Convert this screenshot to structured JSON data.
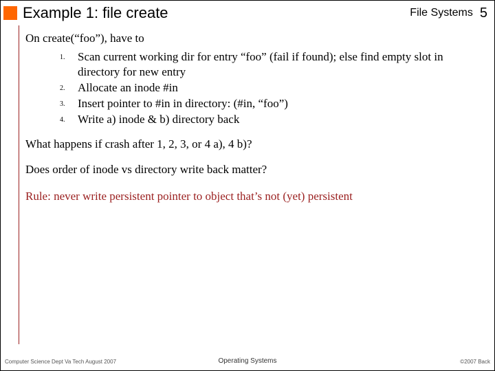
{
  "header": {
    "title": "Example 1: file create",
    "unit": "File Systems",
    "page": "5"
  },
  "body": {
    "lead": "On create(“foo”), have to",
    "steps": [
      {
        "n": "1.",
        "t": "Scan current working dir for entry “foo” (fail if found); else find empty slot in directory for new entry"
      },
      {
        "n": "2.",
        "t": "Allocate an inode #in"
      },
      {
        "n": "3.",
        "t": "Insert pointer to #in in directory: (#in, “foo”)"
      },
      {
        "n": "4.",
        "t": "Write a) inode & b) directory back"
      }
    ],
    "q1": "What happens if crash after 1, 2, 3, or 4 a), 4 b)?",
    "q2": "Does order of inode vs directory write back matter?",
    "rule": "Rule: never write persistent pointer to object that’s not (yet) persistent"
  },
  "footer": {
    "left": "Computer Science Dept Va Tech August 2007",
    "center": "Operating Systems",
    "right": "©2007 Back"
  }
}
